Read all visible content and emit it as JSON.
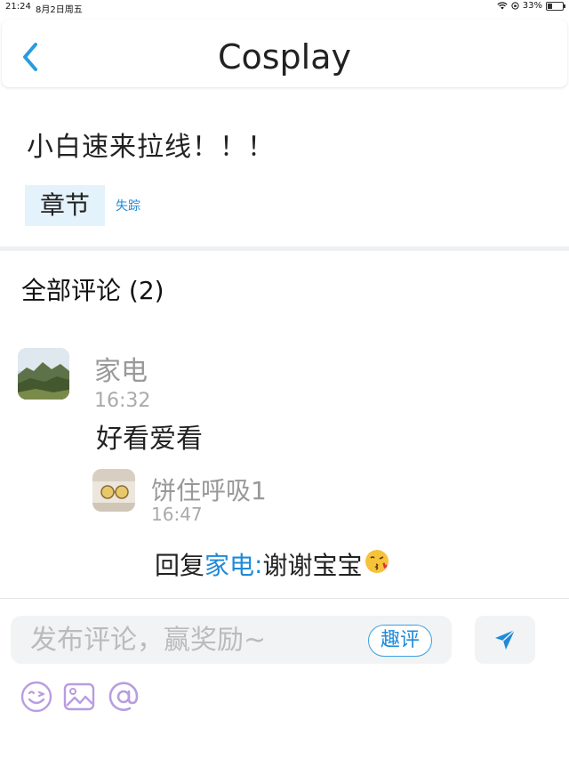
{
  "status_bar": {
    "time": "21:24",
    "date": "8月2日周五",
    "battery": "33%"
  },
  "nav": {
    "title": "Cosplay"
  },
  "post": {
    "title": "小白速来拉线！！！",
    "tag": "章节",
    "link": "失踪"
  },
  "comments": {
    "heading": "全部评论 (2)",
    "items": [
      {
        "author": "家电",
        "time": "16:32",
        "body": "好看爱看",
        "replies": [
          {
            "author": "饼住呼吸1",
            "time": "16:47",
            "prefix": "回复",
            "target": "家电",
            "separator": ":",
            "text": "谢谢宝宝",
            "emoji": "😘"
          }
        ]
      }
    ]
  },
  "composer": {
    "placeholder": "发布评论，赢奖励~",
    "fun_review_label": "趣评",
    "icons": [
      "emoji-icon",
      "image-icon",
      "mention-icon",
      "send-icon"
    ]
  },
  "colors": {
    "accent": "#1f8ad8",
    "tag_bg": "#e4f2fb",
    "toolbar_icon": "#b89de0"
  }
}
